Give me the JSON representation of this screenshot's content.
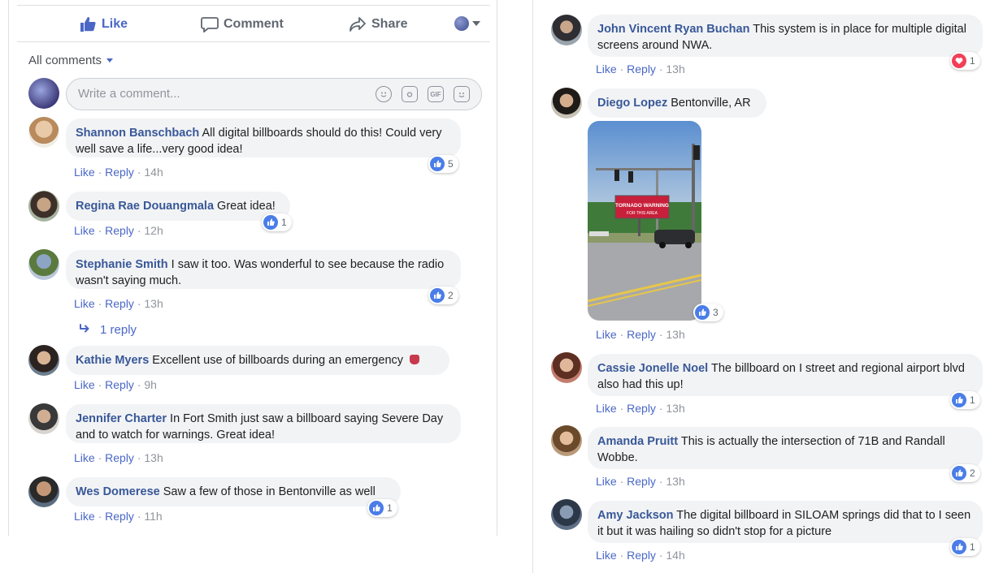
{
  "actions": {
    "like": "Like",
    "comment": "Comment",
    "share": "Share"
  },
  "filter": {
    "label": "All comments"
  },
  "composer": {
    "placeholder": "Write a comment...",
    "gif": "GIF"
  },
  "meta_labels": {
    "like": "Like",
    "reply": "Reply",
    "sep": " · "
  },
  "left_comments": [
    {
      "author": "Shannon Banschbach",
      "text": "All digital billboards should do this! Could very well save a life...very good idea!",
      "time": "14h",
      "reactions": "5",
      "reaction_type": "like"
    },
    {
      "author": "Regina Rae Douangmala",
      "text": "Great idea!",
      "time": "12h",
      "reactions": "1",
      "reaction_type": "like"
    },
    {
      "author": "Stephanie Smith",
      "text": "I saw it too. Was wonderful to see because the radio wasn't saying much.",
      "time": "13h",
      "reactions": "2",
      "reaction_type": "like",
      "reply_link": "1 reply"
    },
    {
      "author": "Kathie Myers",
      "text": "Excellent use of billboards during an emergency",
      "time": "9h"
    },
    {
      "author": "Jennifer Charter",
      "text": "In Fort Smith just saw a billboard saying Severe Day and to watch for warnings. Great idea!",
      "time": "13h"
    },
    {
      "author": "Wes Domerese",
      "text": "Saw a few of those in Bentonville as well",
      "time": "11h",
      "reactions": "1",
      "reaction_type": "like"
    }
  ],
  "right_comments": [
    {
      "author": "John Vincent Ryan Buchan",
      "text": "This system is in place for multiple digital screens around NWA.",
      "time": "13h",
      "reactions": "1",
      "reaction_type": "love"
    },
    {
      "author": "Diego Lopez",
      "text": "Bentonville, AR",
      "time": "13h",
      "reactions": "3",
      "reaction_type": "like",
      "photo_billboard_text": [
        "TORNADO WARNING",
        "FOR THIS AREA"
      ]
    },
    {
      "author": "Cassie Jonelle Noel",
      "text": "The billboard on I street and regional airport blvd also had this up!",
      "time": "13h",
      "reactions": "1",
      "reaction_type": "like"
    },
    {
      "author": "Amanda Pruitt",
      "text": "This is actually the intersection of 71B and Randall Wobbe.",
      "time": "13h",
      "reactions": "2",
      "reaction_type": "like"
    },
    {
      "author": "Amy Jackson",
      "text": "The digital billboard in SILOAM springs did that to I seen it but it was hailing so didn't stop for a picture",
      "time": "14h",
      "reactions": "1",
      "reaction_type": "like"
    }
  ],
  "colors": {
    "link": "#385898",
    "accent": "#4a67c6",
    "bubble": "#f2f3f5",
    "like_badge": "#4a7de8",
    "love_badge": "#f33e58"
  }
}
